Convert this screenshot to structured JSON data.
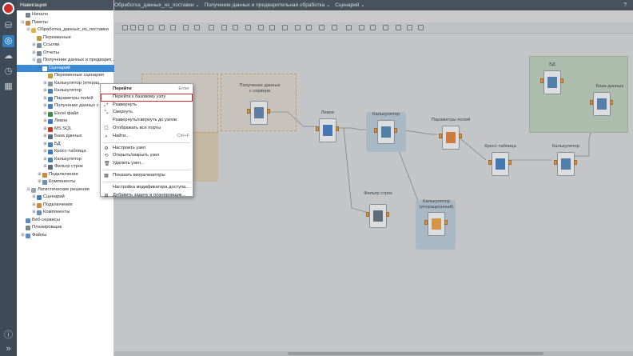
{
  "topbar": {
    "breadcrumbs": [
      "Обработка_данных_из_поставки ⌄",
      "Получение данных и предварительная обработка ⌄",
      "Сценарий ⌄"
    ],
    "help": "?"
  },
  "nav": {
    "title": "Навигация",
    "rows": [
      {
        "label": "Начало",
        "indent": 0,
        "toggle": "",
        "icon": "home",
        "color": "#7a8591"
      },
      {
        "label": "Пакеты",
        "indent": 0,
        "toggle": "⊟",
        "icon": "box",
        "color": "#b8894a"
      },
      {
        "label": "Обработка_данных_из_поставки",
        "indent": 1,
        "toggle": "⊟",
        "icon": "folder",
        "color": "#e0b04b"
      },
      {
        "label": "Переменные",
        "indent": 2,
        "toggle": "",
        "icon": "var",
        "color": "#c59a3a"
      },
      {
        "label": "Ссылки",
        "indent": 2,
        "toggle": "⊞",
        "icon": "link",
        "color": "#7b8a98"
      },
      {
        "label": "Отчеты",
        "indent": 2,
        "toggle": "⊞",
        "icon": "report",
        "color": "#7b8a98"
      },
      {
        "label": "Получение данных и предварит...",
        "indent": 2,
        "toggle": "⊟",
        "icon": "folder",
        "color": "#9aa4ad"
      },
      {
        "label": "Сценарий",
        "indent": 3,
        "toggle": "⊟",
        "icon": "scenario",
        "color": "#ffffff",
        "selected": true
      },
      {
        "label": "Переменные сценария",
        "indent": 4,
        "toggle": "",
        "icon": "var",
        "color": "#c59a3a"
      },
      {
        "label": "Калькулятор (итерац...",
        "indent": 4,
        "toggle": "⊞",
        "icon": "loop",
        "color": "#8a95a0"
      },
      {
        "label": "Калькулятор",
        "indent": 4,
        "toggle": "⊞",
        "icon": "calc",
        "color": "#4a7fb5"
      },
      {
        "label": "Параметры полей",
        "indent": 4,
        "toggle": "⊞",
        "icon": "grid",
        "color": "#4a7fb5"
      },
      {
        "label": "Получение данных с се...",
        "indent": 4,
        "toggle": "⊞",
        "icon": "db",
        "color": "#4a7fb5"
      },
      {
        "label": "Excel файл",
        "indent": 4,
        "toggle": "⊞",
        "icon": "excel",
        "color": "#3e8e4b"
      },
      {
        "label": "Левое",
        "indent": 4,
        "toggle": "⊞",
        "icon": "join",
        "color": "#3a78c0"
      },
      {
        "label": "MS SQL",
        "indent": 4,
        "toggle": "⊞",
        "icon": "db",
        "color": "#c0392b"
      },
      {
        "label": "База данных",
        "indent": 4,
        "toggle": "⊞",
        "icon": "db",
        "color": "#5c6f82"
      },
      {
        "label": "БД",
        "indent": 4,
        "toggle": "⊞",
        "icon": "db",
        "color": "#4a7fb5"
      },
      {
        "label": "Кросс-таблица",
        "indent": 4,
        "toggle": "⊞",
        "icon": "cross",
        "color": "#3a78c0"
      },
      {
        "label": "Калькулятор",
        "indent": 4,
        "toggle": "⊞",
        "icon": "calc",
        "color": "#4a7fb5"
      },
      {
        "label": "Фильтр строк",
        "indent": 4,
        "toggle": "⊞",
        "icon": "filter",
        "color": "#5a6b7c"
      },
      {
        "label": "Подключения",
        "indent": 3,
        "toggle": "⊞",
        "icon": "plug",
        "color": "#d08a3a"
      },
      {
        "label": "Компоненты",
        "indent": 3,
        "toggle": "⊞",
        "icon": "comp",
        "color": "#6a8fb5"
      },
      {
        "label": "Логистические решения",
        "indent": 1,
        "toggle": "⊟",
        "icon": "folder",
        "color": "#9aa4ad"
      },
      {
        "label": "Сценарий",
        "indent": 2,
        "toggle": "⊞",
        "icon": "scenario",
        "color": "#4a7fb5"
      },
      {
        "label": "Подключения",
        "indent": 2,
        "toggle": "⊞",
        "icon": "plug",
        "color": "#d08a3a"
      },
      {
        "label": "Компоненты",
        "indent": 2,
        "toggle": "⊞",
        "icon": "comp",
        "color": "#6a8fb5"
      },
      {
        "label": "Веб-сервисы",
        "indent": 0,
        "toggle": "",
        "icon": "web",
        "color": "#5a8ec0"
      },
      {
        "label": "Планировщик",
        "indent": 0,
        "toggle": "",
        "icon": "clock",
        "color": "#7a8591"
      },
      {
        "label": "Файлы",
        "indent": 0,
        "toggle": "⊞",
        "icon": "files",
        "color": "#5a8ec0"
      }
    ]
  },
  "context_menu": {
    "items": [
      {
        "label": "Перейти",
        "shortcut": "Enter",
        "icon": "",
        "bold": true
      },
      {
        "label": "Перейти к базовому узлу",
        "shortcut": "",
        "icon": "",
        "highlighted": true
      },
      {
        "label": "Развернуть",
        "shortcut": "",
        "icon": "⤢"
      },
      {
        "label": "Свернуть",
        "shortcut": "",
        "icon": "⤡"
      },
      {
        "label": "Развернуть/свернуть до узлов",
        "shortcut": "",
        "icon": ""
      },
      {
        "label": "Отображать все порты",
        "shortcut": "",
        "icon": "☐"
      },
      {
        "label": "Найти...",
        "shortcut": "Ctrl+F",
        "icon": "⌕"
      },
      {
        "sep": true
      },
      {
        "label": "Настроить узел",
        "shortcut": "",
        "icon": "⚙"
      },
      {
        "label": "Открыть/закрыть узел",
        "shortcut": "",
        "icon": "⟲"
      },
      {
        "label": "Удалить узел...",
        "shortcut": "",
        "icon": "🗑"
      },
      {
        "sep": true
      },
      {
        "label": "Показать визуализаторы",
        "shortcut": "",
        "icon": "▦"
      },
      {
        "sep": true
      },
      {
        "label": "Настройка модификатора доступа...",
        "shortcut": "",
        "icon": ""
      },
      {
        "label": "Добавить задачу в планировщик...",
        "shortcut": "",
        "icon": "⊞"
      }
    ]
  },
  "canvas": {
    "nodes": [
      {
        "label": "Получение данных\nс сервера",
        "icon": "db"
      },
      {
        "label": "Левое",
        "icon": "join"
      },
      {
        "label": "Калькулятор",
        "icon": "calc"
      },
      {
        "label": "Параметры полей",
        "icon": "grid"
      },
      {
        "label": "Кросс-таблица",
        "icon": "cross"
      },
      {
        "label": "Калькулятор",
        "icon": "calc"
      },
      {
        "label": "БД",
        "icon": "db"
      },
      {
        "label": "База данных",
        "icon": "db"
      },
      {
        "label": "Фильтр строк",
        "icon": "filter"
      },
      {
        "label": "Калькулятор\n(итерационный)",
        "icon": "loop"
      }
    ]
  },
  "colors": {
    "accent": "#3a8ad6",
    "port": "#e69a3e",
    "highlight": "#d0282e",
    "topbar": "#47525d",
    "rail": "#3d4a57"
  }
}
